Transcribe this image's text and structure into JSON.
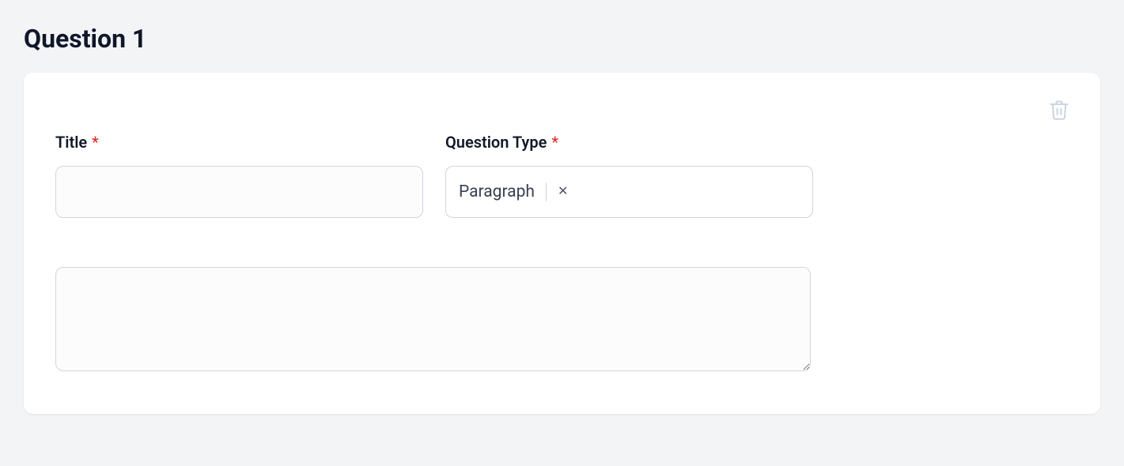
{
  "header": {
    "title": "Question 1"
  },
  "form": {
    "title_label": "Title",
    "title_value": "",
    "type_label": "Question Type",
    "type_selected": "Paragraph",
    "body_value": ""
  }
}
